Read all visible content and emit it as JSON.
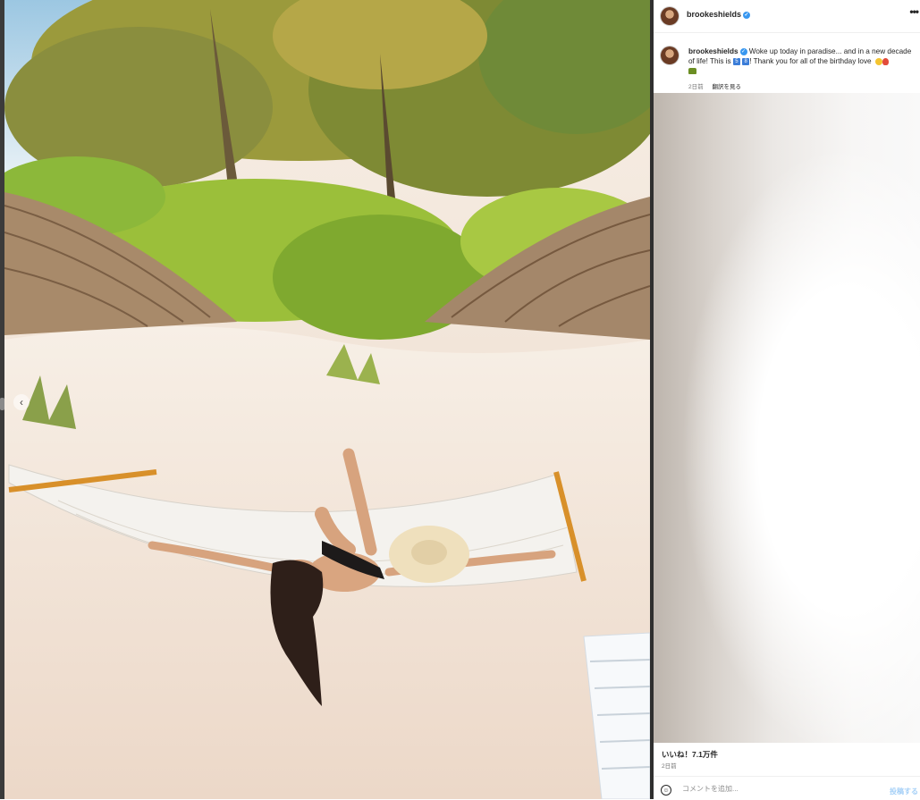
{
  "post": {
    "username": "brookeshields",
    "verified_icon": "verified-badge-icon",
    "more_icon": "more-options-icon",
    "caption": {
      "username": "brookeshields",
      "line1": "Woke up today in paradise... and in a new decade",
      "line2_a": "of life! This is",
      "line2_b": "! Thank you for all of the birthday love",
      "emoji_sq_1": "5",
      "emoji_sq_2": "8"
    },
    "time_ago": "2日前",
    "translate_label": "翻訳を見る",
    "likes_label": "いいね！7.1万件",
    "date_label": "2日前",
    "comment": {
      "placeholder": "コメントを追加...",
      "post_label": "投稿する",
      "emoji_icon": "smiley-icon"
    },
    "photo_alt": "Woman lying in a white rope hammock on a sandy beach under thatched palapa umbrellas"
  },
  "colors": {
    "accent": "#3897f0",
    "post_button_disabled": "#a5d0f7",
    "text": "#262626",
    "muted": "#737373"
  }
}
